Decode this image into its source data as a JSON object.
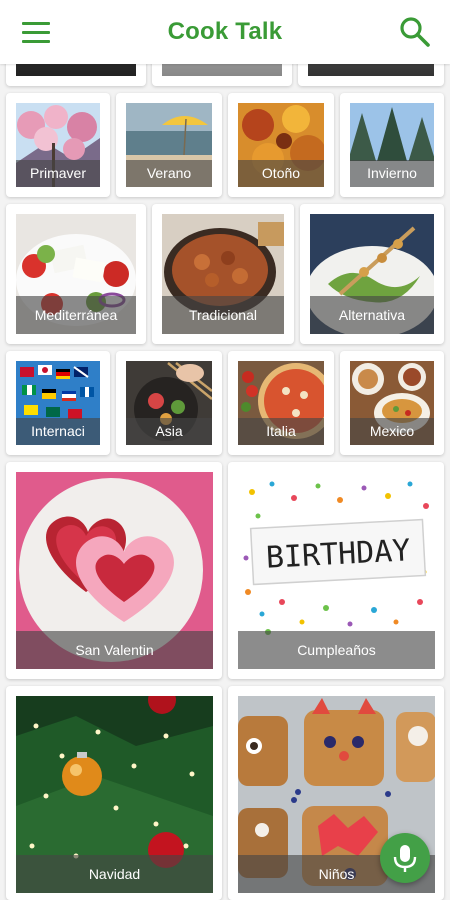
{
  "app": {
    "title": "Cook Talk"
  },
  "icons": {
    "menu": "menu-icon",
    "search": "search-icon",
    "mic": "microphone-icon"
  },
  "colors": {
    "accent": "#3a9b36",
    "fab": "#43a047"
  },
  "categories": {
    "seasons": [
      {
        "label": "Primaver"
      },
      {
        "label": "Verano"
      },
      {
        "label": "Otoño"
      },
      {
        "label": "Invierno"
      }
    ],
    "styles": [
      {
        "label": "Mediterránea"
      },
      {
        "label": "Tradicional"
      },
      {
        "label": "Alternativa"
      }
    ],
    "cuisines": [
      {
        "label": "Internaci"
      },
      {
        "label": "Asia"
      },
      {
        "label": "Italia"
      },
      {
        "label": "Mexico"
      }
    ],
    "occasions": [
      {
        "label": "San Valentin"
      },
      {
        "label": "Cumpleaños"
      }
    ],
    "more": [
      {
        "label": "Navidad"
      },
      {
        "label": "Niños"
      }
    ]
  },
  "birthday_sign": "BIRTHDAY"
}
